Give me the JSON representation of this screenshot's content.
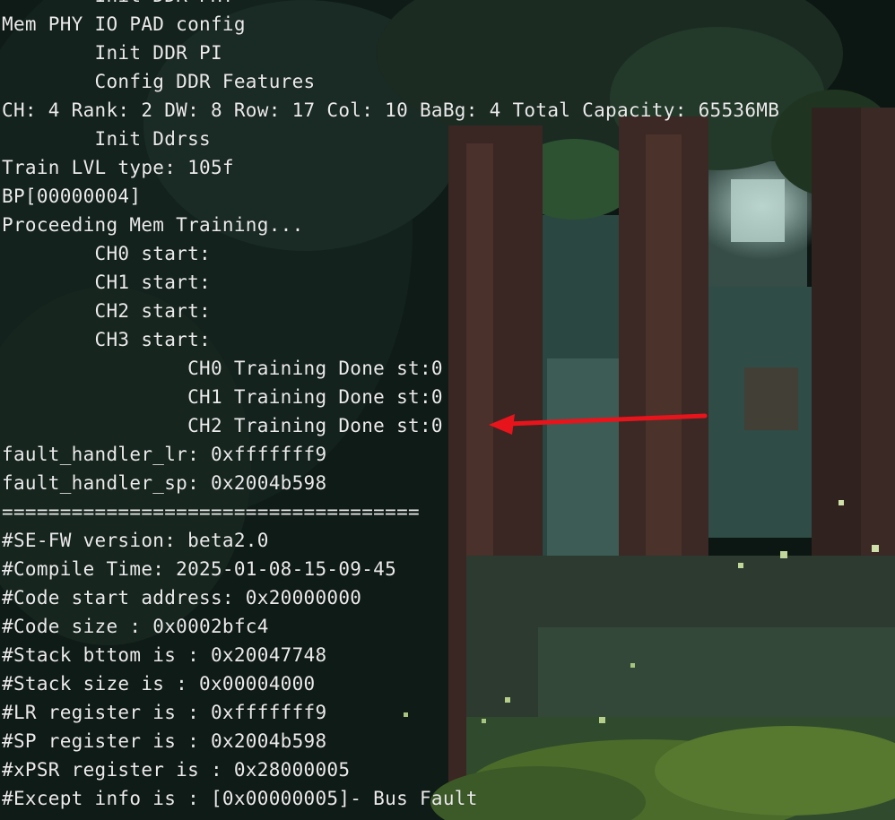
{
  "terminal": {
    "lines": [
      "        Init DDR PHY",
      "Mem PHY IO PAD config",
      "        Init DDR PI",
      "        Config DDR Features",
      "CH: 4 Rank: 2 DW: 8 Row: 17 Col: 10 BaBg: 4 Total Capacity: 65536MB",
      "        Init Ddrss",
      "Train LVL type: 105f",
      "BP[00000004]",
      "Proceeding Mem Training...",
      "        CH0 start:",
      "        CH1 start:",
      "        CH2 start:",
      "        CH3 start:",
      "                CH0 Training Done st:0",
      "                CH1 Training Done st:0",
      "                CH2 Training Done st:0",
      "fault_handler_lr: 0xfffffff9",
      "fault_handler_sp: 0x2004b598",
      "====================================",
      "#SE-FW version: beta2.0",
      "#Compile Time: 2025-01-08-15-09-45",
      "#Code start address: 0x20000000",
      "#Code size : 0x0002bfc4",
      "#Stack bttom is : 0x20047748",
      "#Stack size is : 0x00004000",
      "#LR register is : 0xfffffff9",
      "#SP register is : 0x2004b598",
      "#xPSR register is : 0x28000005",
      "#Except info is : [0x00000005]- Bus Fault"
    ]
  },
  "annotation": {
    "icon": "arrow-left-icon",
    "color": "#e8141c",
    "target_line": 15
  },
  "colors": {
    "text": "#ebebeb",
    "background": "#0b1511"
  }
}
